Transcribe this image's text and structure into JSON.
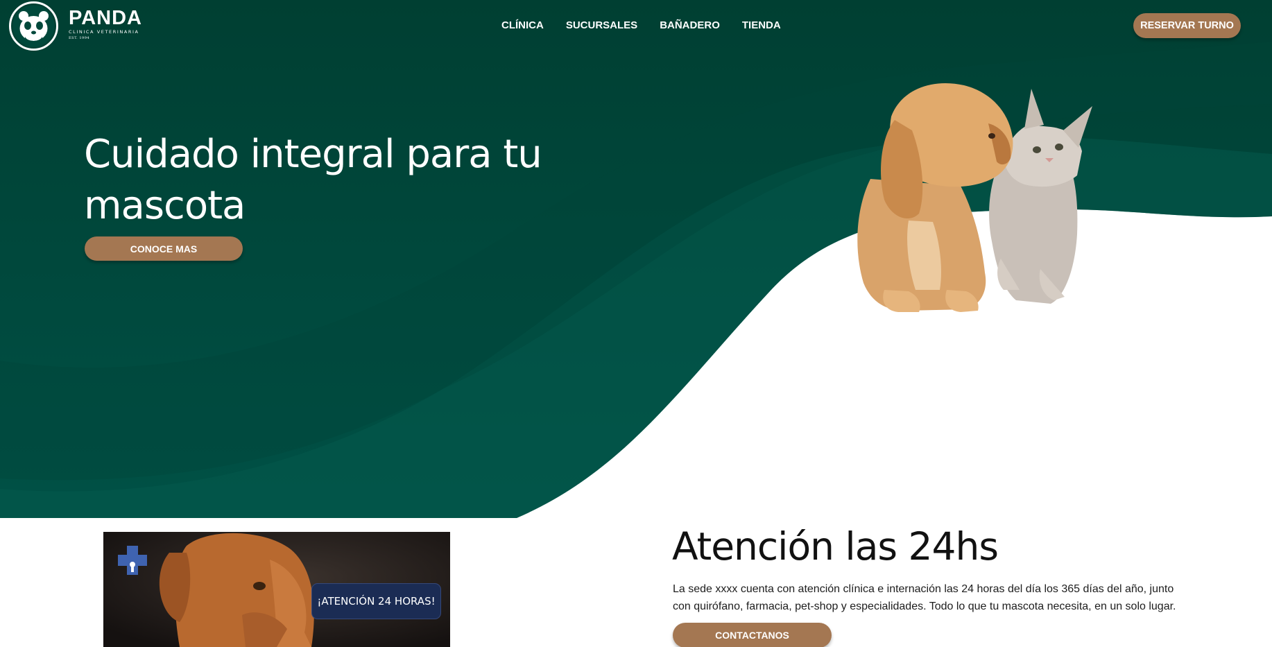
{
  "brand": {
    "name": "PANDA",
    "subtitle": "CLINICA VETERINARIA",
    "established": "EST. 1994"
  },
  "nav": {
    "items": [
      {
        "label": "CLÍNICA"
      },
      {
        "label": "SUCURSALES"
      },
      {
        "label": "BAÑADERO"
      },
      {
        "label": "TIENDA"
      }
    ],
    "cta_label": "RESERVAR TURNO"
  },
  "hero": {
    "title": "Cuidado integral para tu mascota",
    "button_label": "CONOCE MAS",
    "image": "puppy-and-kitten-illustration"
  },
  "section_24h": {
    "image_badge": "¡ATENCIÓN 24 HORAS!",
    "image": "dog-with-medical-cross",
    "title": "Atención las 24hs",
    "text": "La sede xxxx cuenta con atención clínica e internación las 24 horas del día los 365 días del año, junto con quirófano, farmacia, pet-shop y especialidades. Todo lo que tu mascota necesita, en un solo lugar.",
    "button_label": "CONTACTANOS"
  },
  "colors": {
    "hero_green": "#00483b",
    "hero_green_light": "#045a4c",
    "accent_brown": "#a47752",
    "badge_navy": "#1b2c54"
  }
}
